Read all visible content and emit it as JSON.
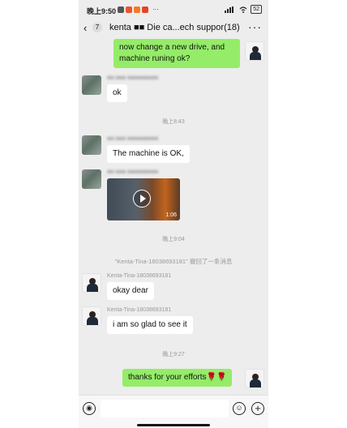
{
  "status_bar": {
    "time": "晚上9:50",
    "more": "···",
    "battery": "52"
  },
  "header": {
    "back_glyph": "‹",
    "unread_count": "7",
    "title": "kenta ■■ Die ca...ech suppor(18)",
    "more_glyph": "···"
  },
  "messages": {
    "m1": {
      "text": "now change a new drive, and machine runing ok?"
    },
    "m2": {
      "sender": "■■ ■■■ ■■■■■■■■■",
      "text": "ok"
    },
    "t1": "晚上8:43",
    "m3": {
      "sender": "■■ ■■■ ■■■■■■■■■",
      "text": "The machine is OK,"
    },
    "m4": {
      "sender": "■■ ■■■ ■■■■■■■■■",
      "video_duration": "1:06"
    },
    "t2": "晚上9:04",
    "recall": "\"Kenta-Tina-18038693181\" 撤回了一条消息",
    "m5": {
      "sender": "Kenta-Tina-18038693181",
      "text": "okay dear"
    },
    "m6": {
      "sender": "Kenta-Tina-18038693181",
      "text": "i am so glad to see it"
    },
    "t3": "晚上9:27",
    "m7": {
      "text": "thanks for your efforts🌹🌹"
    }
  },
  "bottom_bar": {
    "voice_glyph": "◉",
    "emoji_glyph": "☺",
    "plus_glyph": "+"
  },
  "colors": {
    "outgoing_bubble": "#95ec69",
    "incoming_bubble": "#ffffff",
    "chat_background": "#ededed"
  }
}
